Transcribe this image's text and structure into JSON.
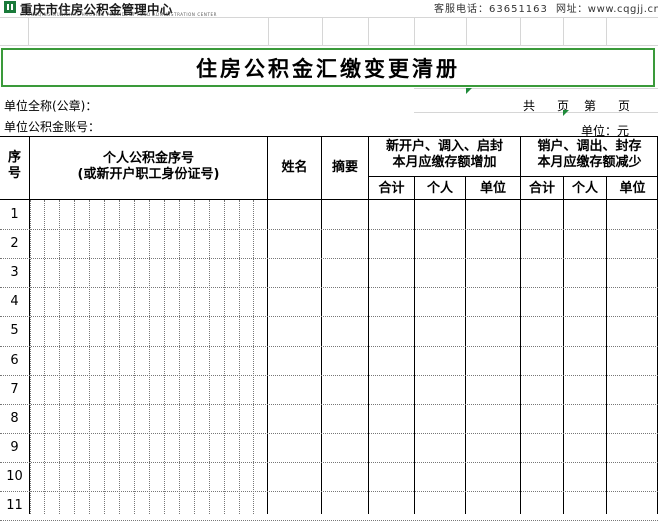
{
  "header": {
    "org_name": "重庆市住房公积金管理中心",
    "org_name_en": "CHONGQING MUNICIPAL HOUSING PROVIDENT FUND ADMINISTRATION CENTER",
    "hotline": "客服电话：63651163",
    "website": "网址：www.cqgjj.cn",
    "logo_color": "#1a7a3a"
  },
  "form": {
    "title": "住房公积金汇缴变更清册",
    "unit_name_label": "单位全称(公章)：",
    "unit_account_label": "单位公积金账号：",
    "total_label": "共",
    "page_label": "页",
    "nth_label": "第",
    "page_label2": "页",
    "currency_unit": "单位：元",
    "title_border_color": "#3a9a3a"
  },
  "table": {
    "col_seq": "序号",
    "col_seq_line1": "序",
    "col_seq_line2": "号",
    "col_account_line1": "个人公积金序号",
    "col_account_line2": "(或新开户职工身份证号)",
    "col_name": "姓名",
    "col_summary": "摘要",
    "increase_line1": "新开户、调入、启封",
    "increase_line2": "本月应缴存额增加",
    "decrease_line1": "销户、调出、封存",
    "decrease_line2": "本月应缴存额减少",
    "sub_total": "合计",
    "sub_personal": "个人",
    "sub_unit": "单位",
    "rows": [
      "1",
      "2",
      "3",
      "4",
      "5",
      "6",
      "7",
      "8",
      "9",
      "10",
      "11"
    ]
  }
}
